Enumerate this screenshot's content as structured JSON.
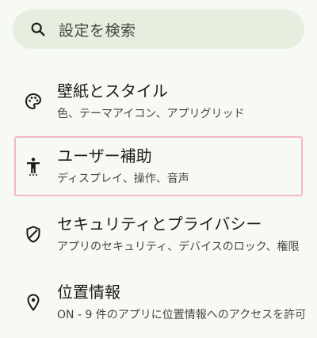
{
  "search": {
    "placeholder": "設定を検索",
    "icon": "search-icon"
  },
  "items": [
    {
      "title": "壁紙とスタイル",
      "subtitle": "色、テーマアイコン、アプリグリッド",
      "icon": "palette-icon"
    },
    {
      "title": "ユーザー補助",
      "subtitle": "ディスプレイ、操作、音声",
      "icon": "accessibility-icon",
      "selected": true
    },
    {
      "title": "セキュリティとプライバシー",
      "subtitle": "アプリのセキュリティ、デバイスのロック、権限",
      "icon": "shield-icon"
    },
    {
      "title": "位置情報",
      "subtitle": "ON - 9 件のアプリに位置情報へのアクセスを許可",
      "icon": "location-pin-icon"
    }
  ],
  "colors": {
    "background": "#f7faf4",
    "search_bg": "#e6eee0",
    "selection_border": "#f4b6c9"
  }
}
